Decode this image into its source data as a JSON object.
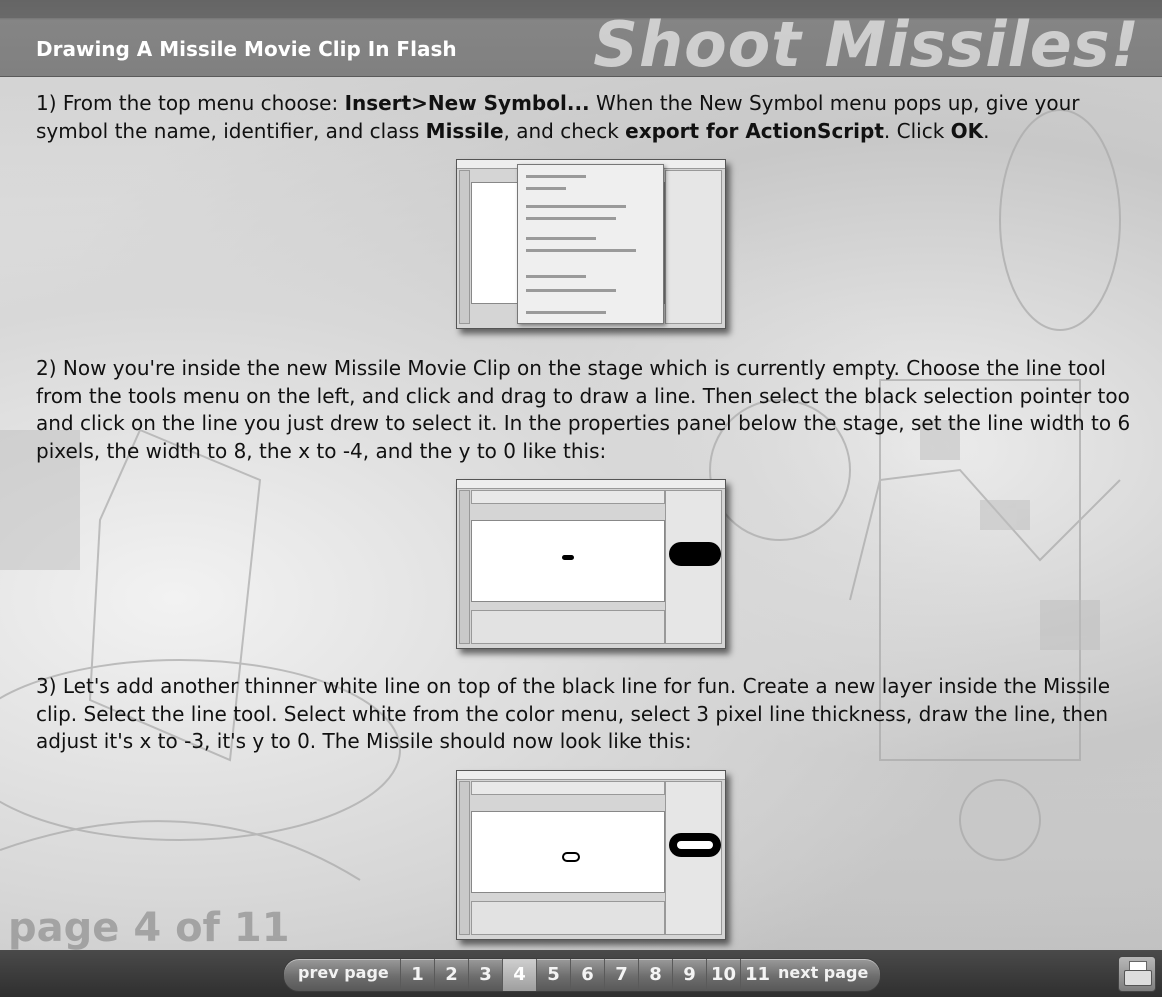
{
  "header": {
    "title": "Drawing A Missile Movie Clip In Flash",
    "logo_text": "Shoot Missiles!"
  },
  "steps": [
    {
      "parts": [
        {
          "t": "1) From the top menu choose:  ",
          "b": false
        },
        {
          "t": "Insert>New Symbol...",
          "b": true
        },
        {
          "t": "  When the New Symbol menu pops up, give your symbol the name, identifier, and class ",
          "b": false
        },
        {
          "t": "Missile",
          "b": true
        },
        {
          "t": ",  and check ",
          "b": false
        },
        {
          "t": "export for ActionScript",
          "b": true
        },
        {
          "t": ". Click ",
          "b": false
        },
        {
          "t": "OK",
          "b": true
        },
        {
          "t": ".",
          "b": false
        }
      ],
      "screenshot": "new-symbol-dialog"
    },
    {
      "parts": [
        {
          "t": "2) Now you're inside the new Missile Movie Clip on the stage which is currently empty. Choose the line tool from the tools menu on the left, and click and drag to draw a line. Then select the black selection pointer too and click on the line you just drew to select it. In the properties panel below the stage, set the line width to 6 pixels, the width to 8, the x to -4, and the y to 0 like this:",
          "b": false
        }
      ],
      "screenshot": "black-line-stage"
    },
    {
      "parts": [
        {
          "t": "3) Let's add another thinner white line on top of the black line for fun. Create a new layer inside the Missile clip. Select the line tool. Select white from the color menu, select 3 pixel line thickness, draw the line, then adjust it's x to -3, it's y to 0. The Missile should now look like this:",
          "b": false
        }
      ],
      "screenshot": "white-line-stage"
    }
  ],
  "page_watermark": "page 4 of 11",
  "nav": {
    "prev_label": "prev page",
    "next_label": "next page",
    "pages": [
      "1",
      "2",
      "3",
      "4",
      "5",
      "6",
      "7",
      "8",
      "9",
      "10",
      "11"
    ],
    "current": "4"
  },
  "footer": {
    "print_icon": "printer-icon"
  },
  "colors": {
    "header_bg": "#7f7f7f",
    "footer_bg": "#333333",
    "active_page": "#b5b5b5"
  }
}
